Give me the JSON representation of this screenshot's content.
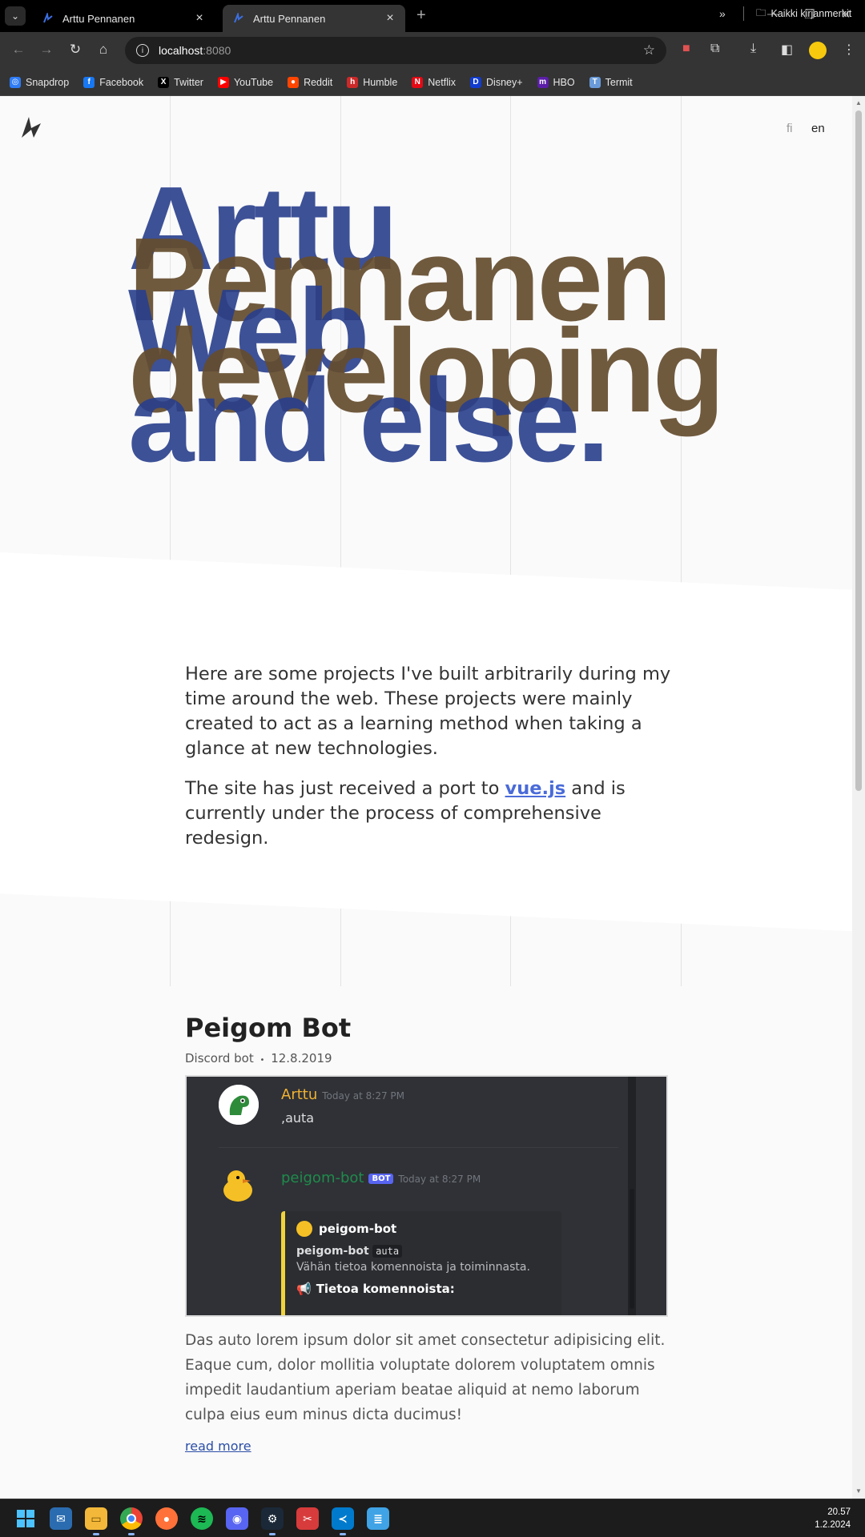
{
  "browser": {
    "tabs": [
      {
        "title": "Arttu Pennanen",
        "active": false
      },
      {
        "title": "Arttu Pennanen",
        "active": true
      }
    ],
    "address": {
      "host": "localhost",
      "port": ":8080"
    },
    "bookmarks": [
      {
        "label": "Snapdrop",
        "icon": "snapdrop-icon",
        "color": "#2f7cf6"
      },
      {
        "label": "Facebook",
        "icon": "facebook-icon",
        "color": "#1877f2"
      },
      {
        "label": "Twitter",
        "icon": "twitter-x-icon",
        "color": "#000000"
      },
      {
        "label": "YouTube",
        "icon": "youtube-icon",
        "color": "#ff0000"
      },
      {
        "label": "Reddit",
        "icon": "reddit-icon",
        "color": "#ff4500"
      },
      {
        "label": "Humble",
        "icon": "humble-icon",
        "color": "#cc2929"
      },
      {
        "label": "Netflix",
        "icon": "netflix-icon",
        "color": "#e50914"
      },
      {
        "label": "Disney+",
        "icon": "disney-icon",
        "color": "#113ccf"
      },
      {
        "label": "HBO",
        "icon": "hbo-icon",
        "color": "#5b1ea8"
      },
      {
        "label": "Termit",
        "icon": "termit-icon",
        "color": "#6a9bd8"
      }
    ],
    "all_bookmarks": "Kaikki kirjanmerkit"
  },
  "page": {
    "lang": {
      "fi": "fi",
      "en": "en"
    },
    "hero": {
      "line1": "Arttu",
      "line2": "Pennanen",
      "line3": "Web",
      "line4": "developing",
      "line5": "and else."
    },
    "intro": {
      "p1": "Here are some projects I've built arbitrarily during my time around the web. These projects were mainly created to act as a learning method when taking a glance at new technologies.",
      "p2_before": "The site has just received a port to ",
      "p2_link": "vue.js",
      "p2_after": " and is currently under the process of comprehensive redesign."
    },
    "project": {
      "title": "Peigom Bot",
      "type": "Discord bot",
      "separator": "•",
      "date": "12.8.2019",
      "description": "Das auto lorem ipsum dolor sit amet consectetur adipisicing elit. Eaque cum, dolor mollitia voluptate dolorem voluptatem omnis impedit laudantium aperiam beatae aliquid at nemo laborum culpa eius eum minus dicta ducimus!",
      "read_more": "read more",
      "screenshot": {
        "user1_name": "Arttu",
        "user1_time": "Today at 8:27 PM",
        "user1_msg": ",auta",
        "user2_name": "peigom-bot",
        "bot_tag": "BOT",
        "user2_time": "Today at 8:27 PM",
        "embed_author": "peigom-bot",
        "embed_cmd_name": "peigom-bot",
        "embed_cmd": "auta",
        "embed_sub": "Vähän tietoa komennoista ja toiminnasta.",
        "embed_field": "Tietoa komennoista:"
      }
    }
  },
  "taskbar": {
    "time": "20.57",
    "date": "1.2.2024"
  },
  "colors": {
    "hero_blue": "#283e8c",
    "hero_brown": "#644c2e",
    "link": "#4a6bd8"
  }
}
